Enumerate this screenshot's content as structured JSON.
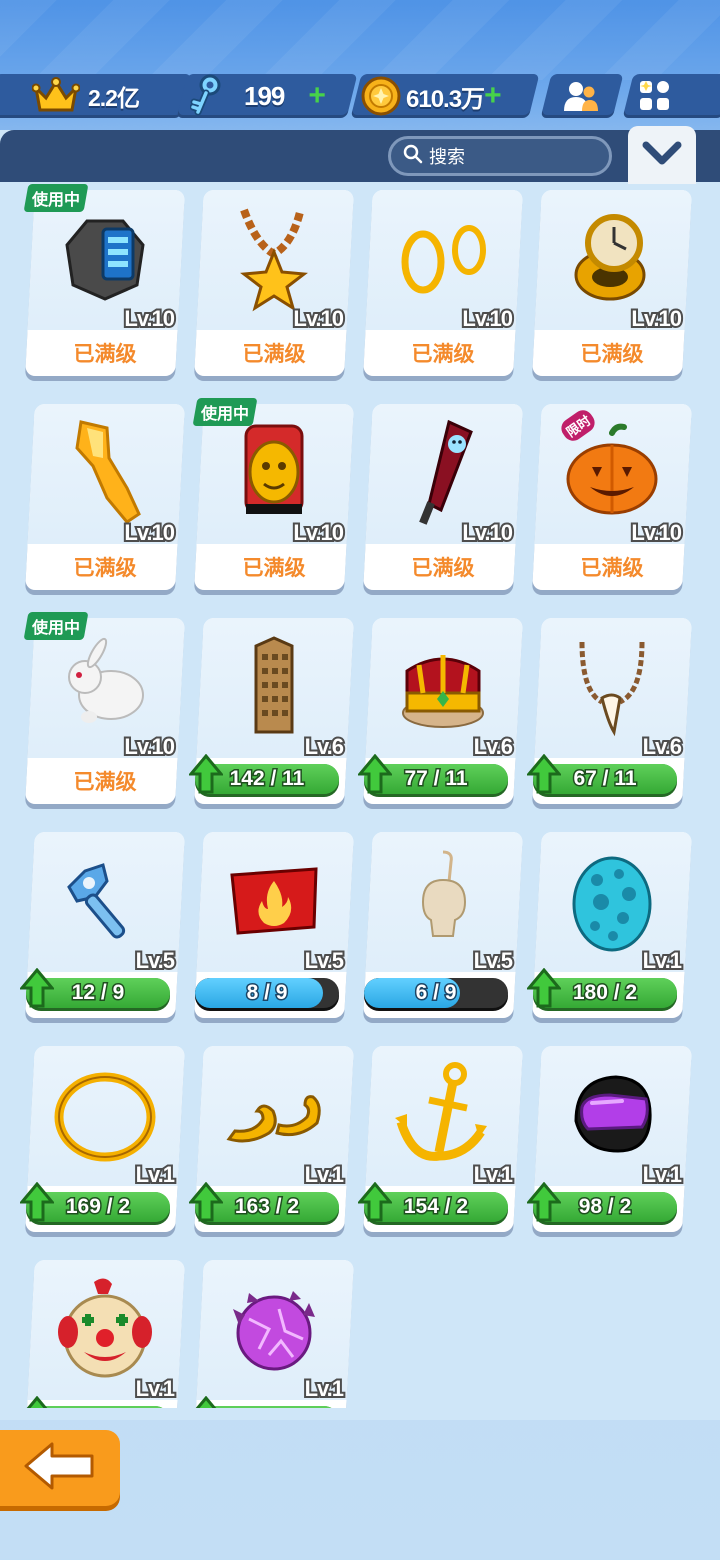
{
  "currencies": {
    "crown": {
      "value": "2.2亿",
      "icon": "crown-icon"
    },
    "key": {
      "value": "199",
      "icon": "key-icon"
    },
    "coin": {
      "value": "610.3万",
      "icon": "coin-icon"
    }
  },
  "search": {
    "placeholder": "搜索"
  },
  "badges": {
    "in_use": "使用中",
    "limited": "限时"
  },
  "status": {
    "maxed": "已满级"
  },
  "items": [
    {
      "name": "hex-watch",
      "level": "Lv.10",
      "maxed": true,
      "in_use": true
    },
    {
      "name": "star-chain-necklace",
      "level": "Lv.10",
      "maxed": true
    },
    {
      "name": "gold-rings",
      "level": "Lv.10",
      "maxed": true
    },
    {
      "name": "pocket-watch-ring",
      "level": "Lv.10",
      "maxed": true
    },
    {
      "name": "golden-blade",
      "level": "Lv.10",
      "maxed": true
    },
    {
      "name": "golden-idol-mask",
      "level": "Lv.10",
      "maxed": true,
      "in_use": true
    },
    {
      "name": "ghost-bat",
      "level": "Lv.10",
      "maxed": true
    },
    {
      "name": "pumpkin",
      "level": "Lv.10",
      "maxed": true,
      "limited": true
    },
    {
      "name": "white-rabbit",
      "level": "Lv.10",
      "maxed": true,
      "in_use": true
    },
    {
      "name": "skyscraper",
      "level": "Lv.6",
      "progress": "142 / 11",
      "fill": 1.0,
      "bar": "green"
    },
    {
      "name": "royal-crown",
      "level": "Lv.6",
      "progress": "77 / 11",
      "fill": 1.0,
      "bar": "green"
    },
    {
      "name": "fang-necklace",
      "level": "Lv.6",
      "progress": "67 / 11",
      "fill": 1.0,
      "bar": "green"
    },
    {
      "name": "wind-up-key",
      "level": "Lv.5",
      "progress": "12 / 9",
      "fill": 1.0,
      "bar": "green"
    },
    {
      "name": "fire-badge",
      "level": "Lv.5",
      "progress": "8 / 9",
      "fill": 0.889,
      "bar": "blue"
    },
    {
      "name": "skull-ornament",
      "level": "Lv.5",
      "progress": "6 / 9",
      "fill": 0.667,
      "bar": "blue"
    },
    {
      "name": "spotted-egg",
      "level": "Lv.1",
      "progress": "180 / 2",
      "fill": 1.0,
      "bar": "green"
    },
    {
      "name": "gold-hoop",
      "level": "Lv.1",
      "progress": "169 / 2",
      "fill": 1.0,
      "bar": "green"
    },
    {
      "name": "gold-mustache",
      "level": "Lv.1",
      "progress": "163 / 2",
      "fill": 1.0,
      "bar": "green"
    },
    {
      "name": "gold-anchor",
      "level": "Lv.1",
      "progress": "154 / 2",
      "fill": 1.0,
      "bar": "green"
    },
    {
      "name": "purple-helmet",
      "level": "Lv.1",
      "progress": "98 / 2",
      "fill": 1.0,
      "bar": "green"
    },
    {
      "name": "clown-mask",
      "level": "Lv.1",
      "progress": "",
      "fill": 1.0,
      "bar": "green"
    },
    {
      "name": "purple-crystal-bush",
      "level": "Lv.1",
      "progress": "",
      "fill": 1.0,
      "bar": "green"
    }
  ],
  "colors": {
    "accent_orange": "#f99b1c",
    "maxed_text": "#f48a2c",
    "progress_green": "#3aa83a",
    "progress_blue": "#2aa7e4",
    "header_navy": "#2f4c78"
  }
}
